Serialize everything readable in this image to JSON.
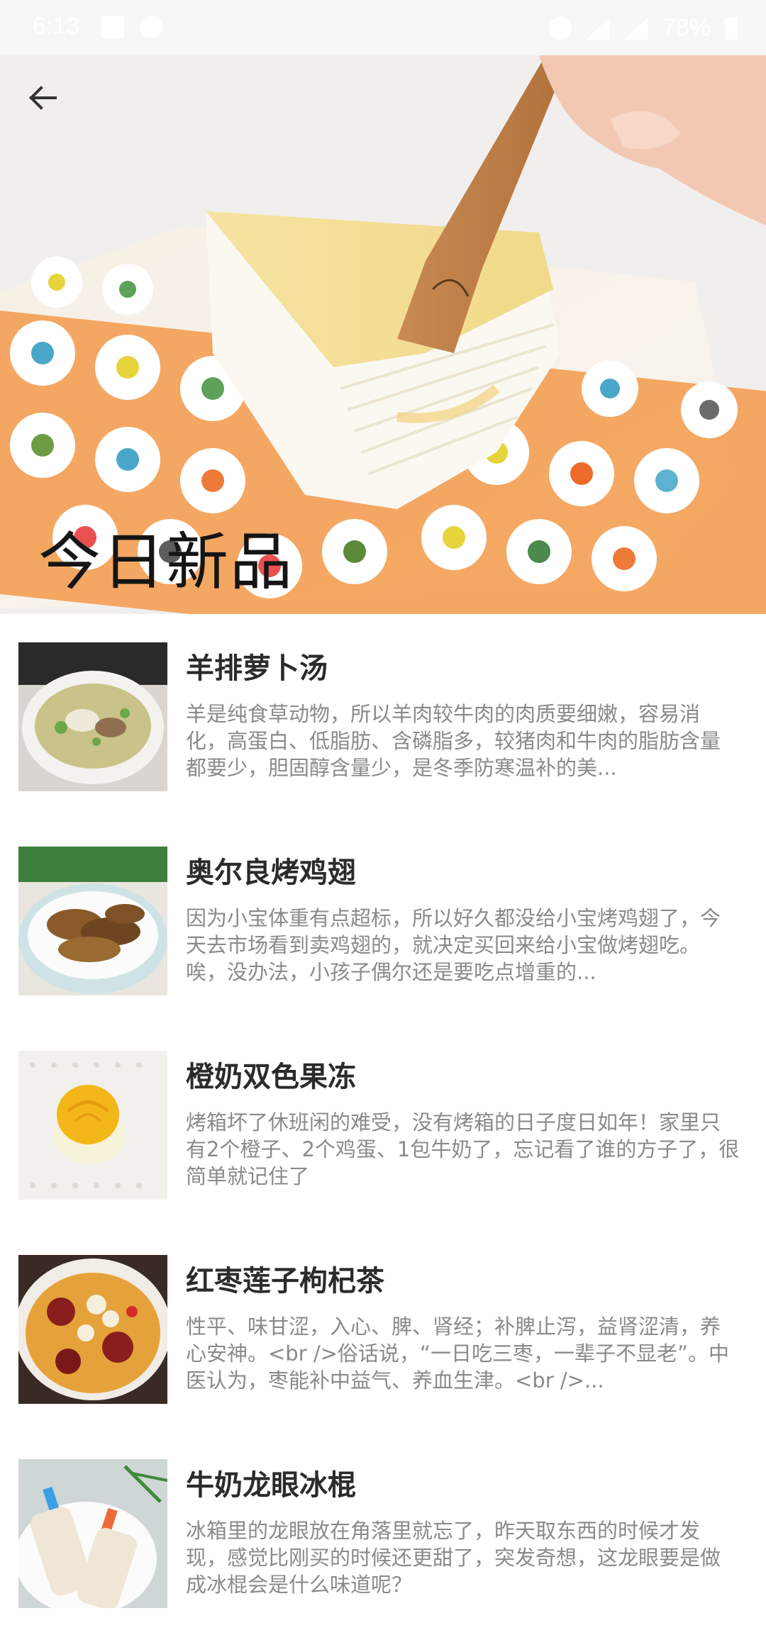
{
  "status_bar": {
    "time": "6:13",
    "battery": "78%"
  },
  "hero": {
    "title": "今日新品",
    "back_icon": "arrow-left-icon"
  },
  "recipes": [
    {
      "title": "羊排萝卜汤",
      "desc": "羊是纯食草动物，所以羊肉较牛肉的肉质要细嫩，容易消化，高蛋白、低脂肪、含磷脂多，较猪肉和牛肉的脂肪含量都要少，胆固醇含量少，是冬季防寒温补的美..."
    },
    {
      "title": "奥尔良烤鸡翅",
      "desc": "因为小宝体重有点超标，所以好久都没给小宝烤鸡翅了，今天去市场看到卖鸡翅的，就决定买回来给小宝做烤翅吃。唉，没办法，小孩子偶尔还是要吃点增重的..."
    },
    {
      "title": "橙奶双色果冻",
      "desc": "烤箱坏了休班闲的难受，没有烤箱的日子度日如年！家里只有2个橙子、2个鸡蛋、1包牛奶了，忘记看了谁的方子了，很简单就记住了"
    },
    {
      "title": "红枣莲子枸杞茶",
      "desc": "性平、味甘涩，入心、脾、肾经；补脾止泻，益肾涩清，养心安神。<br />俗话说，“一日吃三枣，一辈子不显老”。中医认为，枣能补中益气、养血生津。<br />..."
    },
    {
      "title": "牛奶龙眼冰棍",
      "desc": "冰箱里的龙眼放在角落里就忘了，昨天取东西的时候才发现，感觉比刚买的时候还更甜了，突发奇想，这龙眼要是做成冰棍会是什么味道呢？"
    }
  ]
}
